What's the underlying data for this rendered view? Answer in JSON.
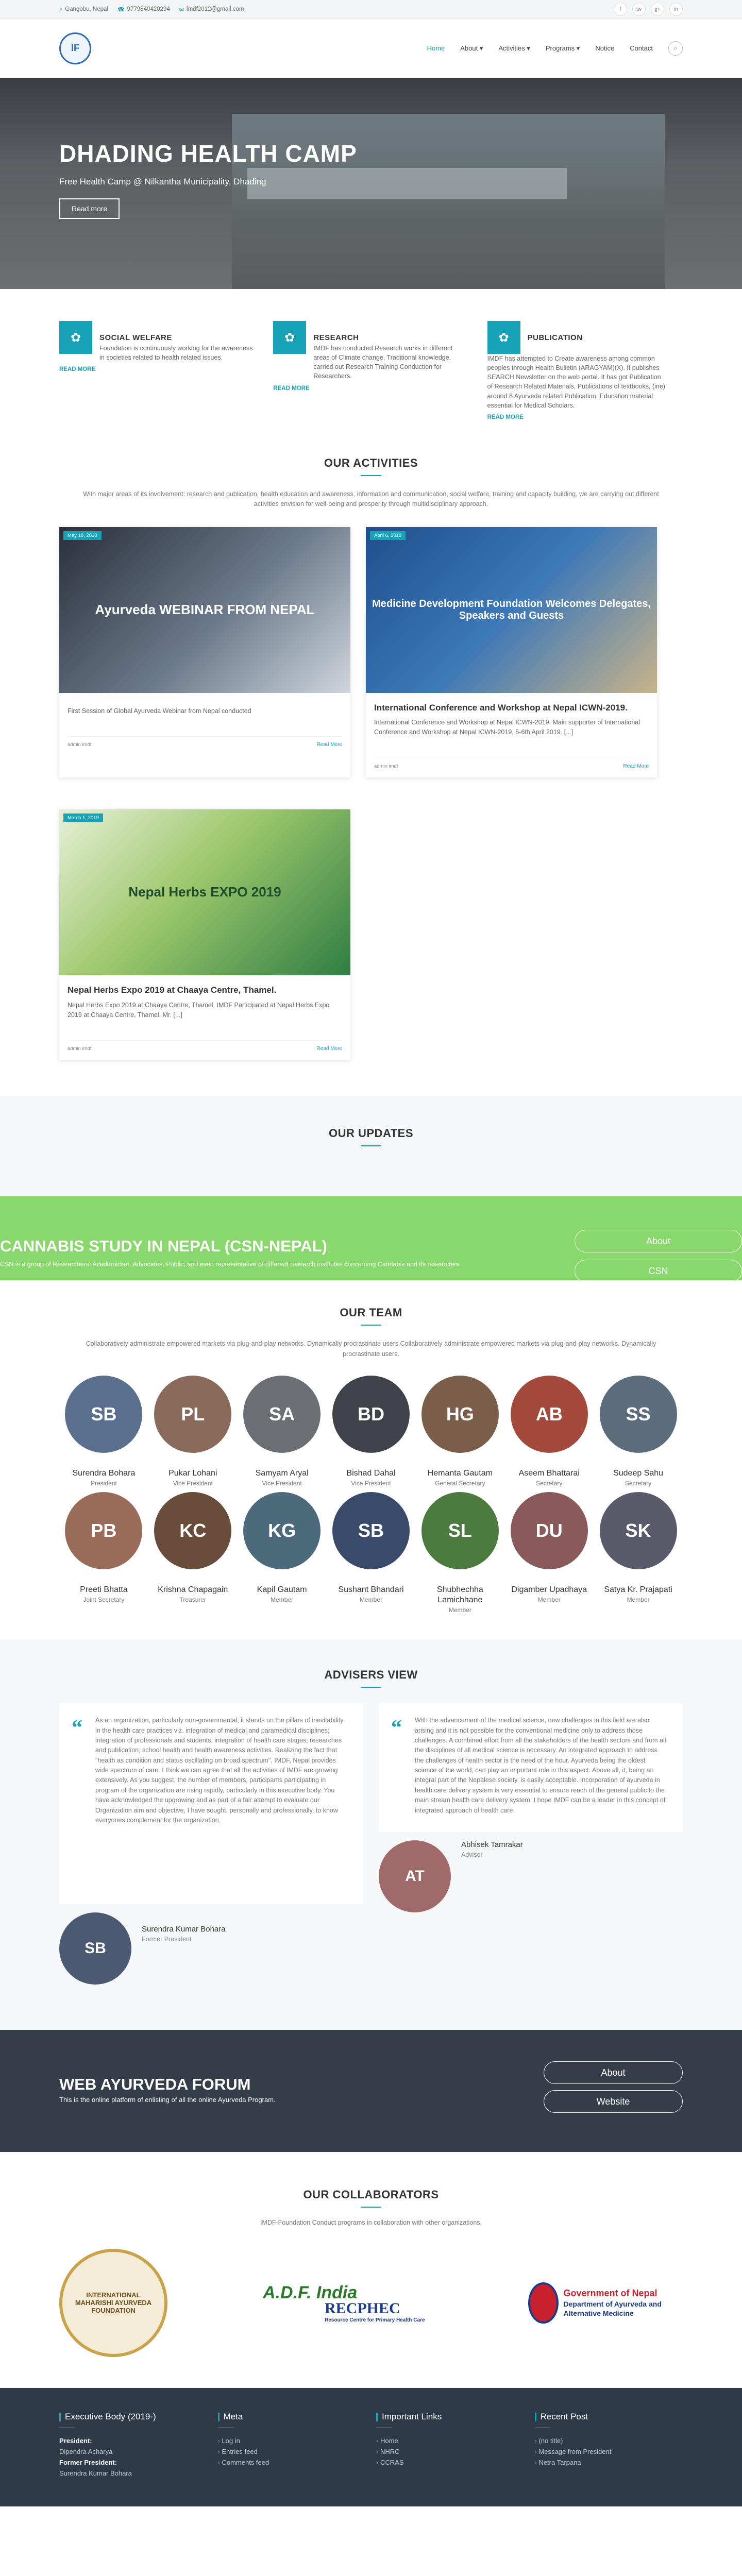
{
  "topbar": {
    "address": "Gangobu, Nepal",
    "phone": "9779840420294",
    "email": "imdf2012@gmail.com",
    "social": [
      "f",
      "tw",
      "g+",
      "in"
    ]
  },
  "header": {
    "logo_text": "IF",
    "nav": [
      "Home",
      "About",
      "Activities",
      "Programs",
      "Notice",
      "Contact"
    ]
  },
  "hero": {
    "title": "DHADING HEALTH CAMP",
    "subtitle": "Free Health Camp @ Nilkantha Municipality, Dhading",
    "button": "Read more"
  },
  "features": [
    {
      "icon": "social-icon",
      "title": "SOCIAL WELFARE",
      "text": "Foundation is continuously working for the awareness in societies related to health related issues.",
      "more": "READ MORE"
    },
    {
      "icon": "research-icon",
      "title": "RESEARCH",
      "text": "IMDF has conducted Research works in different areas of Climate change, Traditional knowledge, carried out Research Training Conduction for Researchers.",
      "more": "READ MORE"
    },
    {
      "icon": "publication-icon",
      "title": "PUBLICATION",
      "text": "IMDF has attempted to Create awareness among common peoples through Health Bulletin (ARAGYAM)(X). It publishes SEARCH Newsletter on the web portal. It has got Publication of Research Related Materials, Publications of textbooks, (ine) around 8 Ayurveda related Publication, Education material essential for Medical Scholars.",
      "more": "READ MORE"
    }
  ],
  "activities": {
    "title": "OUR ACTIVITIES",
    "subtitle": "With major areas of its involvement: research and publication, health education and awareness, information and communication, social welfare, training and capacity building, we are carrying out different activities envision for well-being and prosperity through multidisciplinary approach.",
    "posts": [
      {
        "date": "May 18, 2020",
        "image_text": "Ayurveda WEBINAR FROM NEPAL",
        "title": "",
        "excerpt": "First Session of Global Ayurveda Webinar from Nepal conducted",
        "author": "admin imdf",
        "more": "Read More"
      },
      {
        "date": "April 6, 2019",
        "image_text": "Medicine Development Foundation Welcomes Delegates, Speakers and Guests",
        "title": "International Conference and Workshop at Nepal ICWN-2019.",
        "excerpt": "International Conference and Workshop at Nepal ICWN-2019. Main supporter of International Conference and Workshop at Nepal ICWN-2019, 5-6th April 2019. [...]",
        "author": "admin imdf",
        "more": "Read More"
      },
      {
        "date": "March 1, 2019",
        "image_text": "Nepal Herbs EXPO 2019",
        "title": "Nepal Herbs Expo 2019 at Chaaya Centre, Thamel.",
        "excerpt": "Nepal Herbs Expo 2019 at Chaaya Centre, Thamel. IMDF Participated at Nepal Herbs Expo 2019 at Chaaya Centre, Thamel. Mr. [...]",
        "author": "admin imdf",
        "more": "Read More"
      }
    ]
  },
  "updates": {
    "title": "OUR UPDATES"
  },
  "cannabis": {
    "title": "CANNABIS STUDY IN NEPAL (CSN-NEPAL)",
    "text": "CSN is a group of Researchers, Academician, Advocates, Public, and even representative of different research institutes concerning Cannabis and its researches.",
    "buttons": [
      "About",
      "CSN"
    ]
  },
  "team": {
    "title": "OUR TEAM",
    "subtitle": "Collaboratively administrate empowered markets via plug-and-play networks. Dynamically procrastinate users.Collaboratively administrate empowered markets via plug-and-play networks. Dynamically procrastinate users.",
    "members": [
      {
        "name": "Surendra Bohara",
        "role": "President",
        "color": "#5a6f8e"
      },
      {
        "name": "Pukar Lohani",
        "role": "Vice President",
        "color": "#8a6a5a"
      },
      {
        "name": "Samyam Aryal",
        "role": "Vice President",
        "color": "#6b6f74"
      },
      {
        "name": "Bishad Dahal",
        "role": "Vice President",
        "color": "#3f4248"
      },
      {
        "name": "Hemanta Gautam",
        "role": "General Secretary",
        "color": "#7a5e4a"
      },
      {
        "name": "Aseem Bhattarai",
        "role": "Secretary",
        "color": "#a44a3d"
      },
      {
        "name": "Sudeep Sahu",
        "role": "Secretary",
        "color": "#5b6c7c"
      },
      {
        "name": "Preeti Bhatta",
        "role": "Joint Secretary",
        "color": "#9a6b58"
      },
      {
        "name": "Krishna Chapagain",
        "role": "Treasurer",
        "color": "#6a4c3b"
      },
      {
        "name": "Kapil Gautam",
        "role": "Member",
        "color": "#4d6a7c"
      },
      {
        "name": "Sushant Bhandari",
        "role": "Member",
        "color": "#3a4a6a"
      },
      {
        "name": "Shubhechha Lamichhane",
        "role": "Member",
        "color": "#4c7a3e"
      },
      {
        "name": "Digamber Upadhaya",
        "role": "Member",
        "color": "#8a5a5a"
      },
      {
        "name": "Satya Kr. Prajapati",
        "role": "Member",
        "color": "#5a5a6a"
      }
    ]
  },
  "advisers": {
    "title": "ADVISERS VIEW",
    "items": [
      {
        "quote": "As an organization, particularly non-governmental, it stands on the pillars of inevitability in the health care practices viz. integration of medical and paramedical disciplines; integration of professionals and students; integration of health care stages; researches and publication; school health and health awareness activities. Realizing the fact that \"health as condition and status oscillating on broad spectrum\", IMDF, Nepal provides wide spectrum of care. I think we can agree that all the activities of IMDF are growing extensively. As you suggest, the number of members, participants participating in program of the organization are rising rapidly, particularly in this executive body. You have acknowledged the upgrowing and as part of a fair attempt to evaluate our Organization aim and objective, I have sought, personally and professionally, to know everyones complement for the organization.",
        "name": "Surendra Kumar Bohara",
        "role": "Former President",
        "color": "#4b5a72"
      },
      {
        "quote": "With the advancement of the medical science, new challenges in this field are also arising and it is not possible for the conventional medicine only to address those challenges. A combined effort from all the stakeholders of the health sectors and from all the disciplines of all medical science is necessary. An integrated approach to address the challenges of health sector is the need of the hour. Ayurveda being the oldest science of the world, can play an important role in this aspect. Above all, it, being an integral part of the Nepalese society, is easily acceptable. Incorporation of ayurveda in health care delivery system is very essential to ensure reach of the general public to the main stream health care delivery system. I hope IMDF can be a leader in this concept of integrated approach of health care.",
        "name": "Abhisek Tamrakar",
        "role": "Advisor",
        "color": "#a06a6a"
      }
    ]
  },
  "forum": {
    "title": "WEB AYURVEDA FORUM",
    "text": "This is the online platform of enlisting of all the online Ayurveda Program.",
    "buttons": [
      "About",
      "Website"
    ]
  },
  "collab": {
    "title": "OUR COLLABORATORS",
    "subtitle": "IMDF-Foundation Conduct programs in collaboration with other organizations.",
    "logos": {
      "l1": "INTERNATIONAL MAHARISHI AYURVEDA FOUNDATION",
      "l2a": "A.D.F. India",
      "l2b": "RECPHEC",
      "l2c": "Resource Centre for Primary Health Care",
      "l3a": "Government of Nepal",
      "l3b": "Department of Ayurveda and Alternative Medicine"
    }
  },
  "footer": {
    "cols": [
      {
        "title": "Executive Body (2019-)",
        "items": [
          "President:",
          "Dipendra Acharya",
          "Former President:",
          "Surendra Kumar Bohara"
        ]
      },
      {
        "title": "Meta",
        "items": [
          "Log in",
          "Entries feed",
          "Comments feed"
        ]
      },
      {
        "title": "Important Links",
        "items": [
          "Home",
          "NHRC",
          "CCRAS"
        ]
      },
      {
        "title": "Recent Post",
        "items": [
          "(no title)",
          "Message from President",
          "Netra Tarpana"
        ]
      }
    ]
  }
}
